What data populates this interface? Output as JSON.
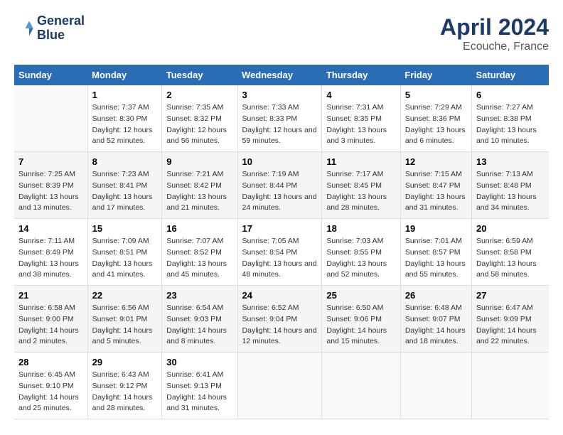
{
  "header": {
    "logo_line1": "General",
    "logo_line2": "Blue",
    "title": "April 2024",
    "subtitle": "Ecouche, France"
  },
  "days_of_week": [
    "Sunday",
    "Monday",
    "Tuesday",
    "Wednesday",
    "Thursday",
    "Friday",
    "Saturday"
  ],
  "weeks": [
    [
      {
        "day": "",
        "sunrise": "",
        "sunset": "",
        "daylight": ""
      },
      {
        "day": "1",
        "sunrise": "Sunrise: 7:37 AM",
        "sunset": "Sunset: 8:30 PM",
        "daylight": "Daylight: 12 hours and 52 minutes."
      },
      {
        "day": "2",
        "sunrise": "Sunrise: 7:35 AM",
        "sunset": "Sunset: 8:32 PM",
        "daylight": "Daylight: 12 hours and 56 minutes."
      },
      {
        "day": "3",
        "sunrise": "Sunrise: 7:33 AM",
        "sunset": "Sunset: 8:33 PM",
        "daylight": "Daylight: 12 hours and 59 minutes."
      },
      {
        "day": "4",
        "sunrise": "Sunrise: 7:31 AM",
        "sunset": "Sunset: 8:35 PM",
        "daylight": "Daylight: 13 hours and 3 minutes."
      },
      {
        "day": "5",
        "sunrise": "Sunrise: 7:29 AM",
        "sunset": "Sunset: 8:36 PM",
        "daylight": "Daylight: 13 hours and 6 minutes."
      },
      {
        "day": "6",
        "sunrise": "Sunrise: 7:27 AM",
        "sunset": "Sunset: 8:38 PM",
        "daylight": "Daylight: 13 hours and 10 minutes."
      }
    ],
    [
      {
        "day": "7",
        "sunrise": "Sunrise: 7:25 AM",
        "sunset": "Sunset: 8:39 PM",
        "daylight": "Daylight: 13 hours and 13 minutes."
      },
      {
        "day": "8",
        "sunrise": "Sunrise: 7:23 AM",
        "sunset": "Sunset: 8:41 PM",
        "daylight": "Daylight: 13 hours and 17 minutes."
      },
      {
        "day": "9",
        "sunrise": "Sunrise: 7:21 AM",
        "sunset": "Sunset: 8:42 PM",
        "daylight": "Daylight: 13 hours and 21 minutes."
      },
      {
        "day": "10",
        "sunrise": "Sunrise: 7:19 AM",
        "sunset": "Sunset: 8:44 PM",
        "daylight": "Daylight: 13 hours and 24 minutes."
      },
      {
        "day": "11",
        "sunrise": "Sunrise: 7:17 AM",
        "sunset": "Sunset: 8:45 PM",
        "daylight": "Daylight: 13 hours and 28 minutes."
      },
      {
        "day": "12",
        "sunrise": "Sunrise: 7:15 AM",
        "sunset": "Sunset: 8:47 PM",
        "daylight": "Daylight: 13 hours and 31 minutes."
      },
      {
        "day": "13",
        "sunrise": "Sunrise: 7:13 AM",
        "sunset": "Sunset: 8:48 PM",
        "daylight": "Daylight: 13 hours and 34 minutes."
      }
    ],
    [
      {
        "day": "14",
        "sunrise": "Sunrise: 7:11 AM",
        "sunset": "Sunset: 8:49 PM",
        "daylight": "Daylight: 13 hours and 38 minutes."
      },
      {
        "day": "15",
        "sunrise": "Sunrise: 7:09 AM",
        "sunset": "Sunset: 8:51 PM",
        "daylight": "Daylight: 13 hours and 41 minutes."
      },
      {
        "day": "16",
        "sunrise": "Sunrise: 7:07 AM",
        "sunset": "Sunset: 8:52 PM",
        "daylight": "Daylight: 13 hours and 45 minutes."
      },
      {
        "day": "17",
        "sunrise": "Sunrise: 7:05 AM",
        "sunset": "Sunset: 8:54 PM",
        "daylight": "Daylight: 13 hours and 48 minutes."
      },
      {
        "day": "18",
        "sunrise": "Sunrise: 7:03 AM",
        "sunset": "Sunset: 8:55 PM",
        "daylight": "Daylight: 13 hours and 52 minutes."
      },
      {
        "day": "19",
        "sunrise": "Sunrise: 7:01 AM",
        "sunset": "Sunset: 8:57 PM",
        "daylight": "Daylight: 13 hours and 55 minutes."
      },
      {
        "day": "20",
        "sunrise": "Sunrise: 6:59 AM",
        "sunset": "Sunset: 8:58 PM",
        "daylight": "Daylight: 13 hours and 58 minutes."
      }
    ],
    [
      {
        "day": "21",
        "sunrise": "Sunrise: 6:58 AM",
        "sunset": "Sunset: 9:00 PM",
        "daylight": "Daylight: 14 hours and 2 minutes."
      },
      {
        "day": "22",
        "sunrise": "Sunrise: 6:56 AM",
        "sunset": "Sunset: 9:01 PM",
        "daylight": "Daylight: 14 hours and 5 minutes."
      },
      {
        "day": "23",
        "sunrise": "Sunrise: 6:54 AM",
        "sunset": "Sunset: 9:03 PM",
        "daylight": "Daylight: 14 hours and 8 minutes."
      },
      {
        "day": "24",
        "sunrise": "Sunrise: 6:52 AM",
        "sunset": "Sunset: 9:04 PM",
        "daylight": "Daylight: 14 hours and 12 minutes."
      },
      {
        "day": "25",
        "sunrise": "Sunrise: 6:50 AM",
        "sunset": "Sunset: 9:06 PM",
        "daylight": "Daylight: 14 hours and 15 minutes."
      },
      {
        "day": "26",
        "sunrise": "Sunrise: 6:48 AM",
        "sunset": "Sunset: 9:07 PM",
        "daylight": "Daylight: 14 hours and 18 minutes."
      },
      {
        "day": "27",
        "sunrise": "Sunrise: 6:47 AM",
        "sunset": "Sunset: 9:09 PM",
        "daylight": "Daylight: 14 hours and 22 minutes."
      }
    ],
    [
      {
        "day": "28",
        "sunrise": "Sunrise: 6:45 AM",
        "sunset": "Sunset: 9:10 PM",
        "daylight": "Daylight: 14 hours and 25 minutes."
      },
      {
        "day": "29",
        "sunrise": "Sunrise: 6:43 AM",
        "sunset": "Sunset: 9:12 PM",
        "daylight": "Daylight: 14 hours and 28 minutes."
      },
      {
        "day": "30",
        "sunrise": "Sunrise: 6:41 AM",
        "sunset": "Sunset: 9:13 PM",
        "daylight": "Daylight: 14 hours and 31 minutes."
      },
      {
        "day": "",
        "sunrise": "",
        "sunset": "",
        "daylight": ""
      },
      {
        "day": "",
        "sunrise": "",
        "sunset": "",
        "daylight": ""
      },
      {
        "day": "",
        "sunrise": "",
        "sunset": "",
        "daylight": ""
      },
      {
        "day": "",
        "sunrise": "",
        "sunset": "",
        "daylight": ""
      }
    ]
  ]
}
